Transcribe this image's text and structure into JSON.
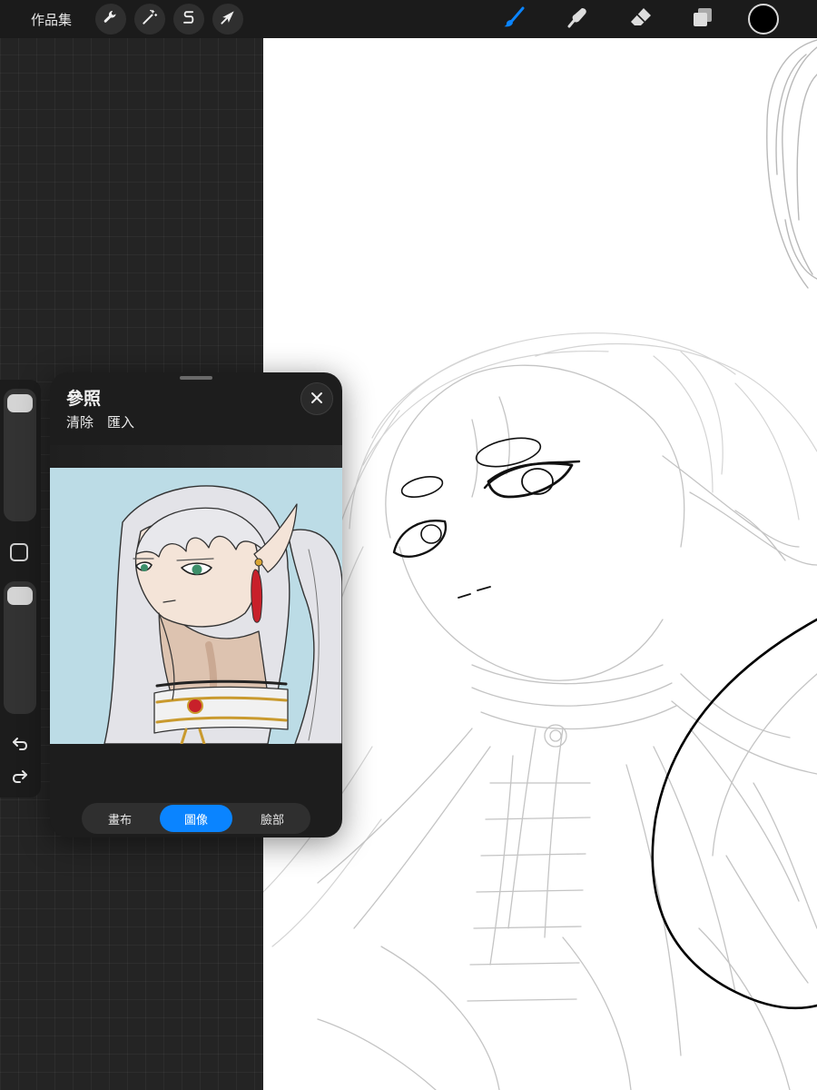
{
  "topbar": {
    "gallery_label": "作品集",
    "left_tools": [
      {
        "name": "actions",
        "icon": "wrench-icon"
      },
      {
        "name": "adjustments",
        "icon": "magic-wand-icon"
      },
      {
        "name": "selection",
        "icon": "selection-s-icon"
      },
      {
        "name": "transform",
        "icon": "arrow-cursor-icon"
      }
    ],
    "right_tools": [
      {
        "name": "brush",
        "icon": "brush-icon",
        "active": true
      },
      {
        "name": "smudge",
        "icon": "smudge-icon"
      },
      {
        "name": "eraser",
        "icon": "eraser-icon"
      },
      {
        "name": "layers",
        "icon": "layers-icon"
      }
    ],
    "current_color": "#000000",
    "accent_color": "#0a84ff"
  },
  "sidebar": {
    "undo_icon": "undo-icon",
    "redo_icon": "redo-icon"
  },
  "reference_panel": {
    "title": "參照",
    "clear_label": "清除",
    "import_label": "匯入",
    "tabs": [
      {
        "label": "畫布",
        "active": false
      },
      {
        "label": "圖像",
        "active": true
      },
      {
        "label": "臉部",
        "active": false
      }
    ]
  }
}
